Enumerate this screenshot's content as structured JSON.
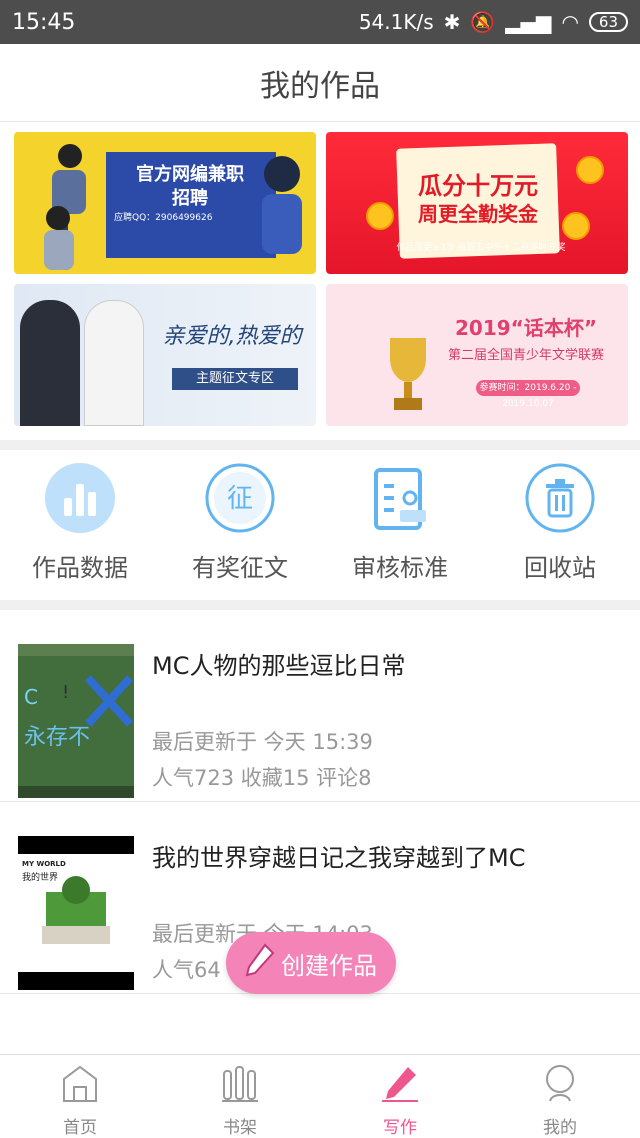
{
  "status": {
    "time": "15:45",
    "network_speed": "54.1K/s",
    "battery": "63"
  },
  "header": {
    "title": "我的作品"
  },
  "banners": [
    {
      "line1": "官方网编兼职",
      "line2": "招聘",
      "line3": "应聘QQ：2906499626"
    },
    {
      "line1": "瓜分十万元",
      "line2": "周更全勤奖金",
      "line3": "作品周更≥3次·每周五中午十二点准时开奖"
    },
    {
      "line1": "亲爱的,热爱的",
      "line2": "主题征文专区"
    },
    {
      "line1": "2019“话本杯”",
      "line2": "第二届全国青少年文学联赛",
      "line3": "参赛时间：2019.6.20 - 2019.10.07"
    }
  ],
  "quick_actions": [
    {
      "label": "作品数据",
      "icon": "bar-chart-icon"
    },
    {
      "label": "有奖征文",
      "icon": "contest-icon"
    },
    {
      "label": "审核标准",
      "icon": "review-icon"
    },
    {
      "label": "回收站",
      "icon": "trash-icon"
    }
  ],
  "works": [
    {
      "title": "MC人物的那些逗比日常",
      "updated": "最后更新于 今天 15:39",
      "stats": "人气723  收藏15  评论8"
    },
    {
      "title": "我的世界穿越日记之我穿越到了MC",
      "updated": "最后更新于 今天 14:03",
      "stats": "人气64",
      "cover_title_en": "MY WORLD",
      "cover_title_cn": "我的世界"
    }
  ],
  "fab": {
    "label": "创建作品"
  },
  "tabs": [
    {
      "label": "首页",
      "active": false
    },
    {
      "label": "书架",
      "active": false
    },
    {
      "label": "写作",
      "active": true
    },
    {
      "label": "我的",
      "active": false
    }
  ],
  "colors": {
    "accent": "#f0568e",
    "icon_blue": "#62b4f0"
  }
}
